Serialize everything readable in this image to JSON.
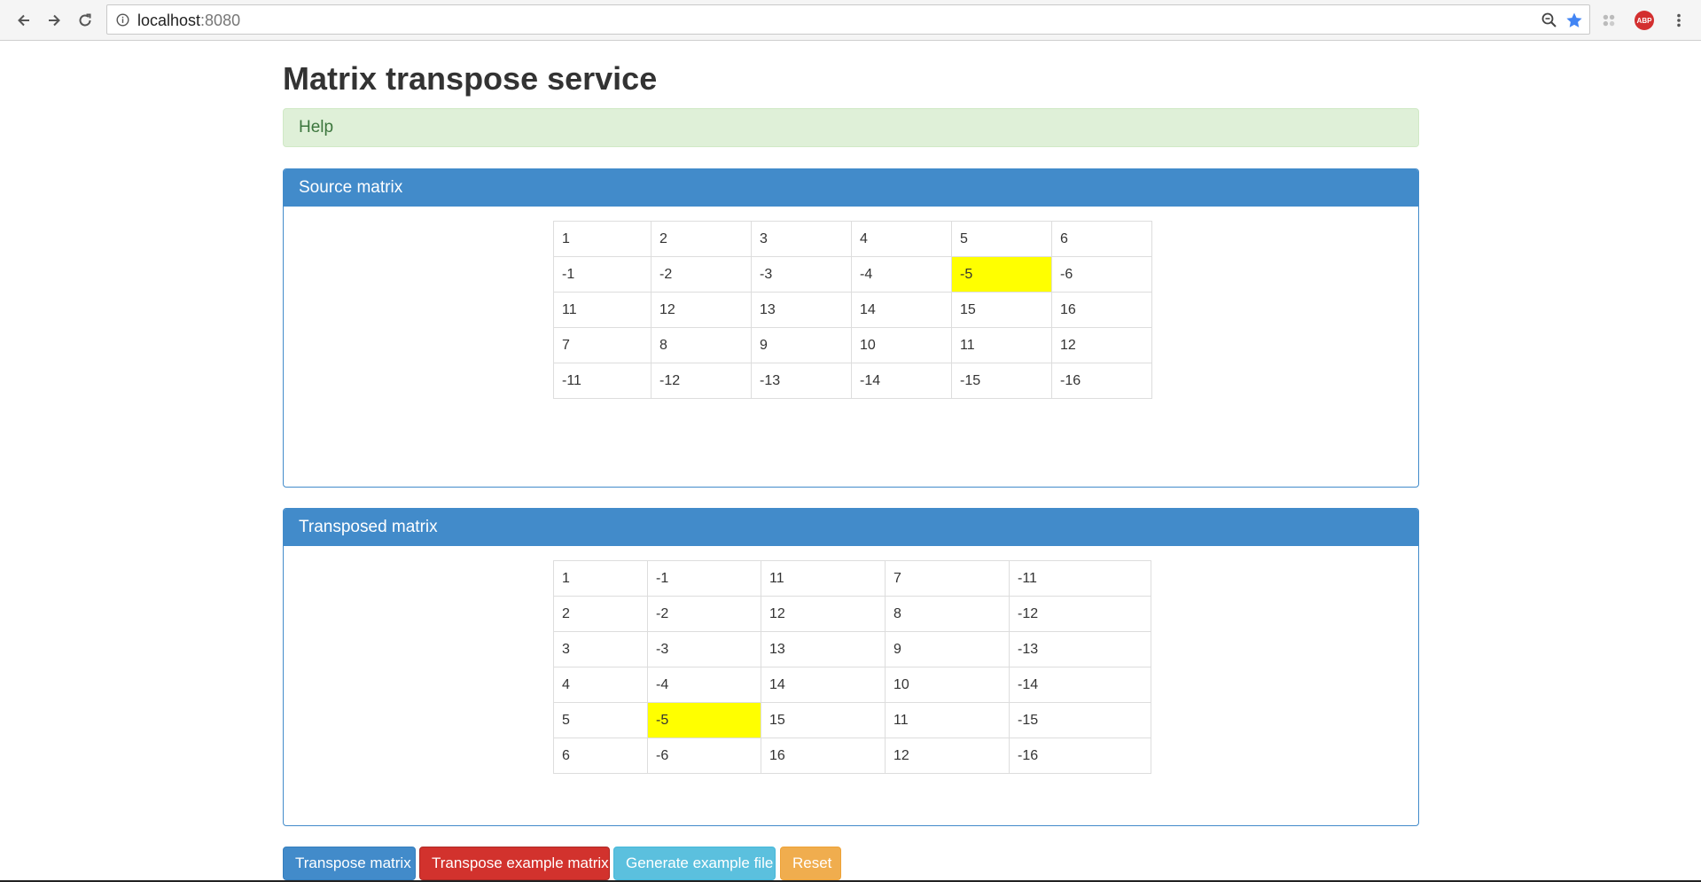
{
  "browser": {
    "url_host": "localhost",
    "url_port": ":8080",
    "icons": [
      "back-icon",
      "forward-icon",
      "reload-icon",
      "info-icon",
      "zoom-icon",
      "star-icon",
      "extension-icon",
      "adblock-icon",
      "menu-icon"
    ],
    "adblock_label": "ABP"
  },
  "page": {
    "title": "Matrix transpose service",
    "help_label": "Help"
  },
  "source_panel": {
    "heading": "Source matrix",
    "rows": [
      [
        "1",
        "2",
        "3",
        "4",
        "5",
        "6"
      ],
      [
        "-1",
        "-2",
        "-3",
        "-4",
        "-5",
        "-6"
      ],
      [
        "11",
        "12",
        "13",
        "14",
        "15",
        "16"
      ],
      [
        "7",
        "8",
        "9",
        "10",
        "11",
        "12"
      ],
      [
        "-11",
        "-12",
        "-13",
        "-14",
        "-15",
        "-16"
      ]
    ],
    "highlight": {
      "row": 1,
      "col": 4
    }
  },
  "transposed_panel": {
    "heading": "Transposed matrix",
    "rows": [
      [
        "1",
        "-1",
        "11",
        "7",
        "-11"
      ],
      [
        "2",
        "-2",
        "12",
        "8",
        "-12"
      ],
      [
        "3",
        "-3",
        "13",
        "9",
        "-13"
      ],
      [
        "4",
        "-4",
        "14",
        "10",
        "-14"
      ],
      [
        "5",
        "-5",
        "15",
        "11",
        "-15"
      ],
      [
        "6",
        "-6",
        "16",
        "12",
        "-16"
      ]
    ],
    "highlight": {
      "row": 4,
      "col": 1
    }
  },
  "buttons": {
    "transpose": "Transpose matrix",
    "transpose_example": "Transpose example matrix",
    "generate_file": "Generate example file",
    "reset": "Reset"
  },
  "colors": {
    "primary": "#428bca",
    "danger": "#d2322d",
    "info": "#5bc0de",
    "warning": "#f0ad4e",
    "help_bg": "#dff0d8",
    "highlight": "#ffff00"
  }
}
